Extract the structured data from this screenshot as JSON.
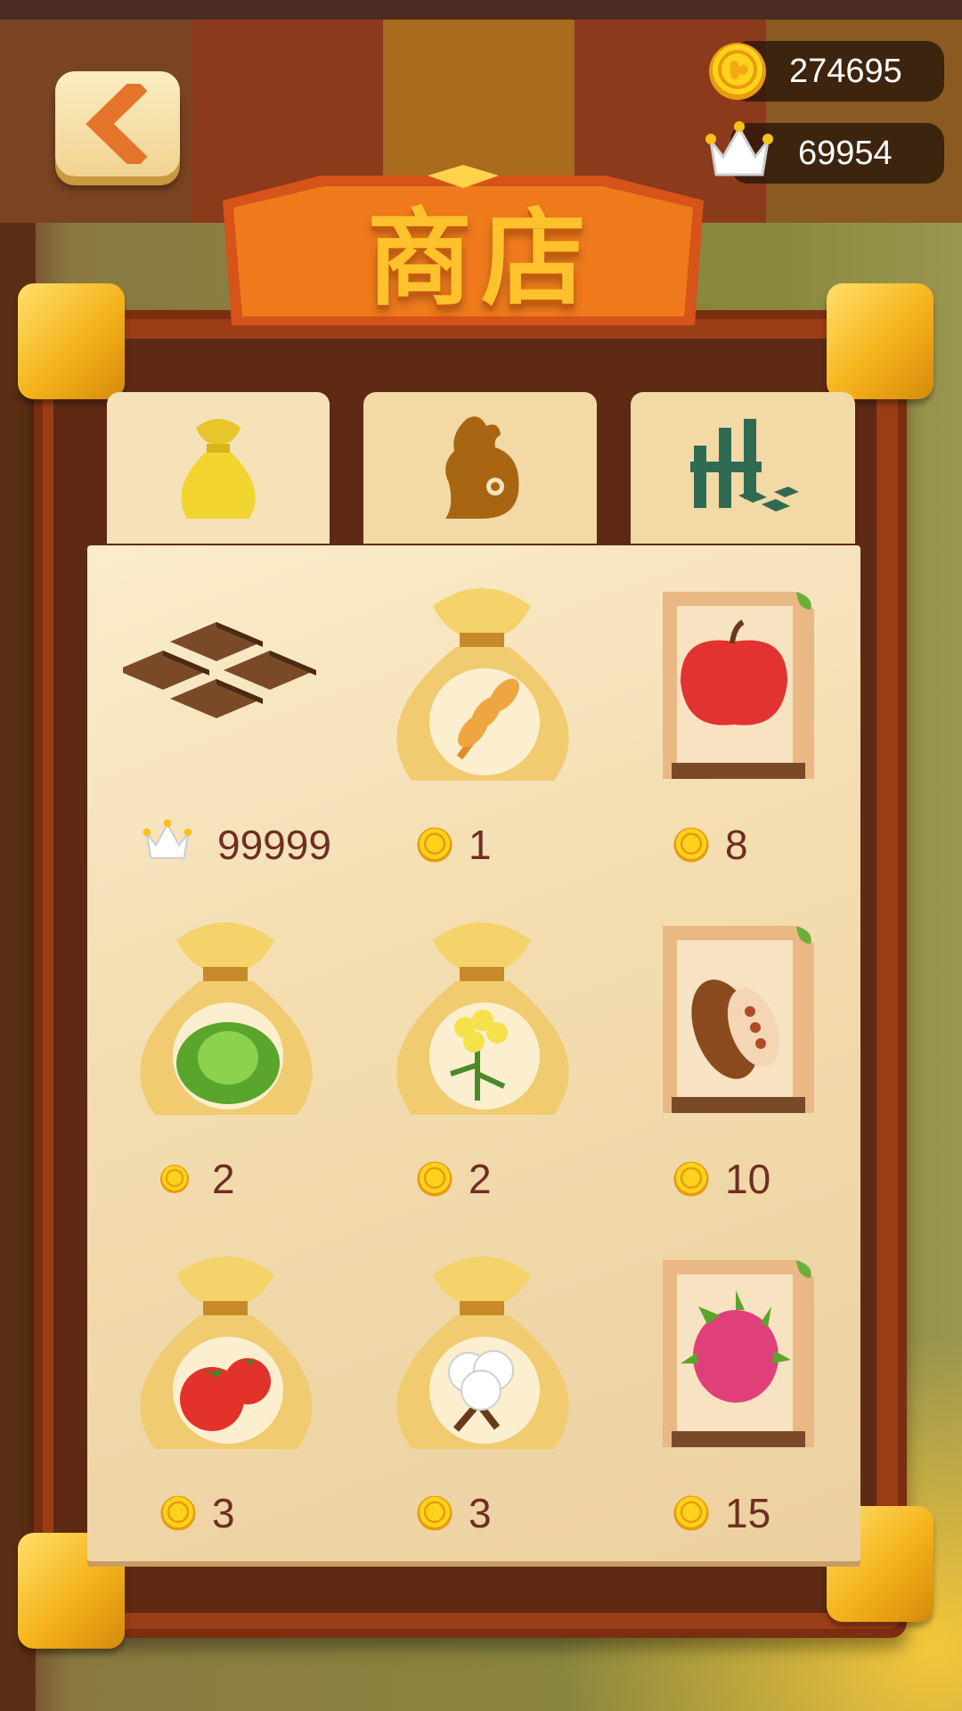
{
  "currency": {
    "coins": "274695",
    "crowns": "69954"
  },
  "header": {
    "title": "商店"
  },
  "tabs": [
    {
      "icon": "seed-bag-icon",
      "active": true
    },
    {
      "icon": "chicken-icon",
      "active": false
    },
    {
      "icon": "fence-building-icon",
      "active": false
    }
  ],
  "items": [
    {
      "icon": "farm-plot-icon",
      "currency_icon": "crown-icon",
      "price": "99999"
    },
    {
      "icon": "wheat-seed-bag-icon",
      "currency_icon": "coin-icon",
      "price": "1"
    },
    {
      "icon": "apple-seed-packet-icon",
      "currency_icon": "coin-icon",
      "price": "8"
    },
    {
      "icon": "cabbage-seed-bag-icon",
      "currency_icon": "coin-icon",
      "price": "2"
    },
    {
      "icon": "rapeseed-flower-seed-bag-icon",
      "currency_icon": "coin-icon",
      "price": "2"
    },
    {
      "icon": "cocoa-seed-packet-icon",
      "currency_icon": "coin-icon",
      "price": "10"
    },
    {
      "icon": "tomato-seed-bag-icon",
      "currency_icon": "coin-icon",
      "price": "3"
    },
    {
      "icon": "cotton-seed-bag-icon",
      "currency_icon": "coin-icon",
      "price": "3"
    },
    {
      "icon": "dragonfruit-seed-packet-icon",
      "currency_icon": "coin-icon",
      "price": "15"
    }
  ],
  "colors": {
    "price_text": "#6e2e22",
    "title_gold": "#ffc22c",
    "panel_bg": "#f6e2b8",
    "board_frame": "#9b3e18"
  }
}
